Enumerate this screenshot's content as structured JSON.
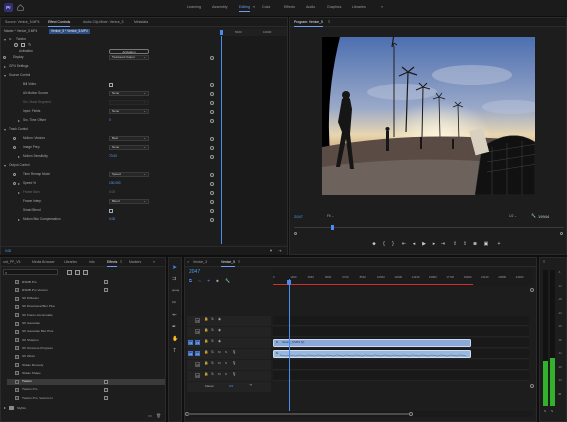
{
  "app": {
    "logo": "Pr"
  },
  "workspaces": [
    "Learning",
    "Assembly",
    "Editing",
    "Color",
    "Effects",
    "Audio",
    "Graphics",
    "Libraries"
  ],
  "active_workspace": "Editing",
  "source_panel": {
    "tabs": [
      "Source: Venice_5.MP4",
      "Effect Controls",
      "Audio Clip Mixer: Venice_5",
      "Metadata"
    ],
    "active_tab": "Effect Controls",
    "breadcrumb_master": "Master * Venice_5.MP4",
    "breadcrumb_clip": "Venice_5 * Venice_5.MP4",
    "timecode_left": "5000",
    "timecode_right": "10000",
    "effect_name": "Twixtor",
    "activation_label": "Activation",
    "activation_button": "Activation",
    "rows": [
      {
        "label": "Display",
        "value": "Twixtored Output",
        "kind": "dropdown",
        "indent": 12,
        "stopwatch": true
      },
      {
        "label": "GPU Settings",
        "kind": "group",
        "indent": 8,
        "tri": "r"
      },
      {
        "label": "Source Control",
        "kind": "group",
        "indent": 8,
        "tri": "d"
      },
      {
        "label": "Bill Video",
        "kind": "check",
        "indent": 22
      },
      {
        "label": "Alt Motion Source",
        "value": "None",
        "kind": "dropdown",
        "indent": 22
      },
      {
        "label": "Src. Mask Segment",
        "value": "",
        "kind": "dropdown-dim",
        "indent": 22,
        "dim": true
      },
      {
        "label": "Input: Fields",
        "value": "None",
        "kind": "dropdown",
        "indent": 22
      },
      {
        "label": "Src. Time Offset",
        "value": "0",
        "kind": "number",
        "indent": 22,
        "tri": "r"
      },
      {
        "label": "Track Control",
        "kind": "group",
        "indent": 8,
        "tri": "d"
      },
      {
        "label": "Motion: Vectors",
        "value": "Best",
        "kind": "dropdown",
        "indent": 22,
        "stopwatch": true
      },
      {
        "label": "Image Prep",
        "value": "None",
        "kind": "dropdown",
        "indent": 22,
        "stopwatch": true
      },
      {
        "label": "Motion Sensitivity",
        "value": "70.00",
        "kind": "number",
        "indent": 22,
        "tri": "r"
      },
      {
        "label": "Output Control",
        "kind": "group",
        "indent": 8,
        "tri": "d"
      },
      {
        "label": "Time Remap Mode",
        "value": "Speed",
        "kind": "dropdown",
        "indent": 22,
        "stopwatch": true
      },
      {
        "label": "Speed %",
        "value": "100.000",
        "kind": "number",
        "indent": 22,
        "tri": "r",
        "stopwatch": true
      },
      {
        "label": "Frame Num",
        "value": "0.00",
        "kind": "number",
        "indent": 22,
        "dim": true,
        "tri": "r"
      },
      {
        "label": "Frame Interp",
        "value": "Blend",
        "kind": "dropdown",
        "indent": 22
      },
      {
        "label": "Smart Blend",
        "kind": "check",
        "indent": 22
      },
      {
        "label": "Motion Blur Compensation",
        "value": "0.00",
        "kind": "number",
        "indent": 22,
        "tri": "r"
      }
    ],
    "bottom_timecode": "0:00"
  },
  "program_monitor": {
    "title": "Program: Venice_5",
    "timecode": "2047",
    "fit": "Fit",
    "quality": "1/2",
    "duration": "19944"
  },
  "project_panel": {
    "tabs": [
      "ord_PP_V5",
      "Media Browser",
      "Libraries",
      "Info",
      "Effects",
      "Markers"
    ],
    "active_tab": "Effects",
    "search_placeholder": "",
    "items": [
      "RSMB Pro",
      "RSMB Pro Vectors",
      "SK Diffusion",
      "SK Directional Blur Plus",
      "SK Frame Accumulate",
      "SK Gaussian",
      "SK Gaussian Blur Plus",
      "SK Sharpen",
      "SK Structure Progress",
      "SK Zilium",
      "Shade Remedy",
      "Shade Shape",
      "Twixtor",
      "Twixtor Pro",
      "Twixtor Pro, Vectors In"
    ],
    "selected_item": "Twixtor",
    "folder": "Stylize"
  },
  "timeline": {
    "tabs": [
      "Venice_3",
      "Venice_5"
    ],
    "active_tab": "Venice_5",
    "timecode": "2047",
    "ruler_labels": [
      "0",
      "1920",
      "2840",
      "5000",
      "6720",
      "8540",
      "10500",
      "12000",
      "14240",
      "15800",
      "17720",
      "19000",
      "21120",
      "22800",
      "24000"
    ],
    "tracks": [
      {
        "name": "V3",
        "type": "video"
      },
      {
        "name": "V2",
        "type": "video"
      },
      {
        "name": "V1",
        "type": "video",
        "source": "V1"
      },
      {
        "name": "A1",
        "type": "audio",
        "source": "A1"
      },
      {
        "name": "A2",
        "type": "audio"
      },
      {
        "name": "A3",
        "type": "audio"
      }
    ],
    "master_label": "Master",
    "master_value": "0.0",
    "clip_label": "Venice_5.MP4 [V]",
    "playhead_frac": 0.06,
    "clip_start_frac": 0.0,
    "clip_end_frac": 0.76
  },
  "audio_meters": {
    "labels": [
      "-6",
      "-12",
      "-18",
      "-24",
      "-30",
      "-36",
      "-42",
      "-48",
      "-54",
      "dB"
    ],
    "levels": [
      0.33,
      0.35
    ],
    "bottom": [
      "S",
      "S"
    ]
  },
  "colors": {
    "accent": "#6c9df6",
    "selection": "#2e5d9f",
    "playhead": "#4a8cf0",
    "clip_video": "#8aa9d8",
    "clip_audio": "#98b8de",
    "meter": "#33b02c"
  }
}
